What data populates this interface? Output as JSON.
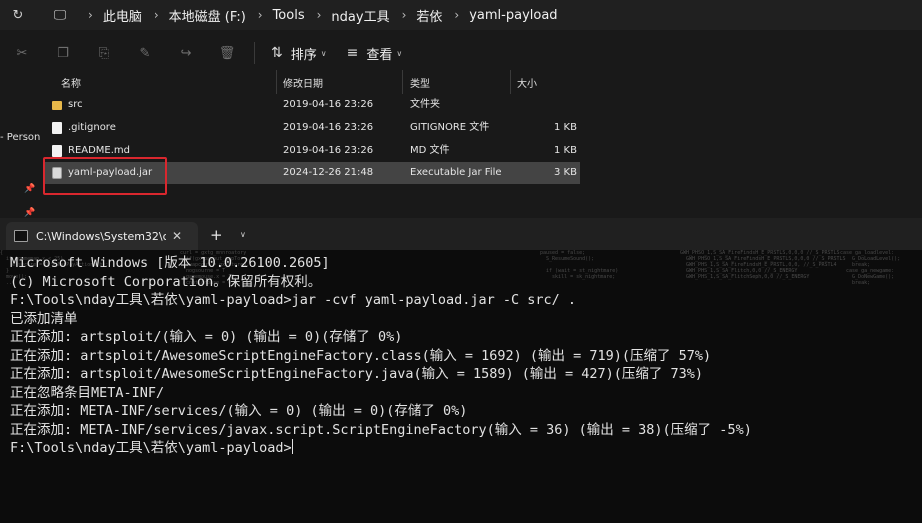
{
  "explorer": {
    "breadcrumb": [
      "此电脑",
      "本地磁盘 (F:)",
      "Tools",
      "nday工具",
      "若依",
      "yaml-payload"
    ],
    "toolbar": {
      "sort_label": "排序",
      "view_label": "查看"
    },
    "nav_label": "- Person",
    "columns": {
      "name": "名称",
      "date": "修改日期",
      "type": "类型",
      "size": "大小"
    },
    "files": [
      {
        "name": "src",
        "date": "2019-04-16 23:26",
        "type": "文件夹",
        "size": "",
        "icon": "folder-icon"
      },
      {
        "name": ".gitignore",
        "date": "2019-04-16 23:26",
        "type": "GITIGNORE 文件",
        "size": "1 KB",
        "icon": "file-icon"
      },
      {
        "name": "README.md",
        "date": "2019-04-16 23:26",
        "type": "MD 文件",
        "size": "1 KB",
        "icon": "file-icon"
      },
      {
        "name": "yaml-payload.jar",
        "date": "2024-12-26 21:48",
        "type": "Executable Jar File",
        "size": "3 KB",
        "icon": "jar-icon"
      }
    ],
    "highlight_color": "#d9272e"
  },
  "terminal": {
    "tab_title": "C:\\Windows\\System32\\cmd.exe",
    "lines": [
      "Microsoft Windows [版本 10.0.26100.2605]",
      "(c) Microsoft Corporation。保留所有权利。",
      "",
      "F:\\Tools\\nday工具\\若依\\yaml-payload>jar -cvf yaml-payload.jar -C src/ .",
      "已添加清单",
      "正在添加: artsploit/(输入 = 0) (输出 = 0)(存储了 0%)",
      "正在添加: artsploit/AwesomeScriptEngineFactory.class(输入 = 1692) (输出 = 719)(压缩了 57%)",
      "正在添加: artsploit/AwesomeScriptEngineFactory.java(输入 = 1589) (输出 = 427)(压缩了 73%)",
      "正在忽略条目META-INF/",
      "正在添加: META-INF/services/(输入 = 0) (输出 = 0)(存储了 0%)",
      "正在添加: META-INF/services/javax.script.ScriptEngineFactory(输入 = 36) (输出 = 38)(压缩了 -5%)",
      "",
      "F:\\Tools\\nday工具\\若依\\yaml-payload>"
    ]
  }
}
